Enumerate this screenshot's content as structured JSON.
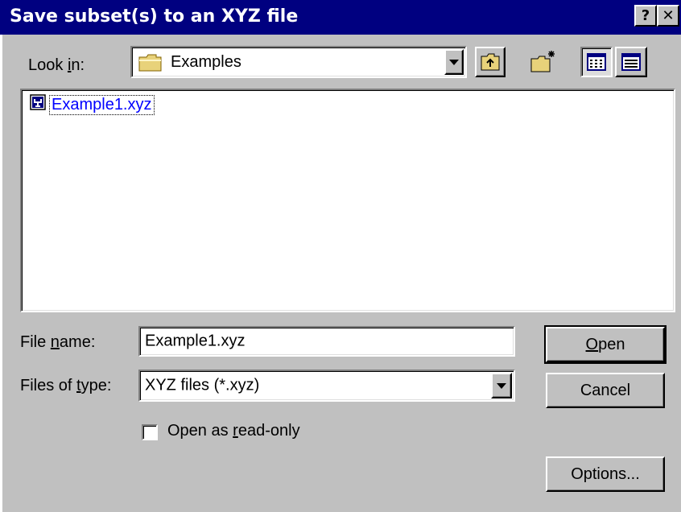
{
  "window": {
    "title": "Save subset(s) to an XYZ file",
    "help_button": "?",
    "close_button": "✕"
  },
  "lookin": {
    "label_pre": "Look ",
    "label_accel": "i",
    "label_post": "n:",
    "value": "Examples"
  },
  "files": [
    {
      "name": "Example1.xyz",
      "icon": "xyz-file-icon"
    }
  ],
  "filename": {
    "label_pre": "File ",
    "label_accel": "n",
    "label_post": "ame:",
    "value": "Example1.xyz"
  },
  "filetype": {
    "label_pre": "Files of ",
    "label_accel": "t",
    "label_post": "ype:",
    "value": "XYZ files (*.xyz)"
  },
  "readonly": {
    "label_pre": "Open as ",
    "label_accel": "r",
    "label_post": "ead-only",
    "checked": false
  },
  "buttons": {
    "open_accel": "O",
    "open_rest": "pen",
    "cancel": "Cancel",
    "options": "Options..."
  },
  "colors": {
    "titlebar": "#000080",
    "face": "#c0c0c0",
    "link": "#0000ff"
  }
}
